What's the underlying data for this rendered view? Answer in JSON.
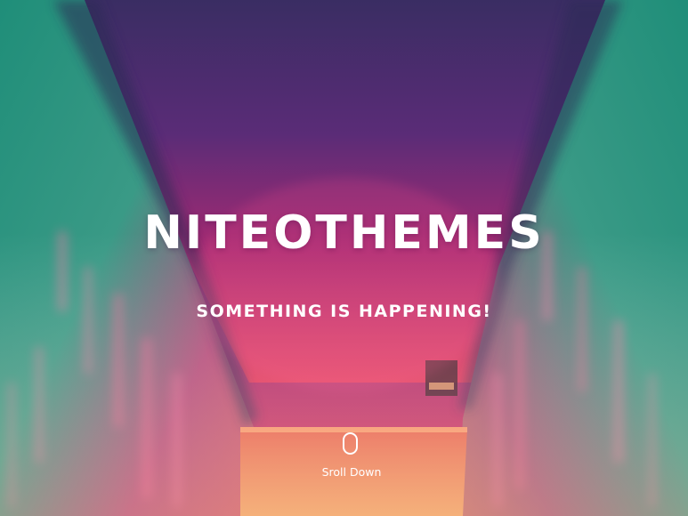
{
  "hero": {
    "title": "NITEOTHEMES",
    "subtitle": "SOMETHING IS HAPPENING!"
  },
  "scroll": {
    "label": "Sroll Down",
    "icon": "mouse-icon"
  },
  "colors": {
    "text": "#ffffff",
    "teal": "#2e9e88",
    "purple": "#4b2a74",
    "magenta": "#c8276a",
    "orange": "#f2a35a"
  }
}
